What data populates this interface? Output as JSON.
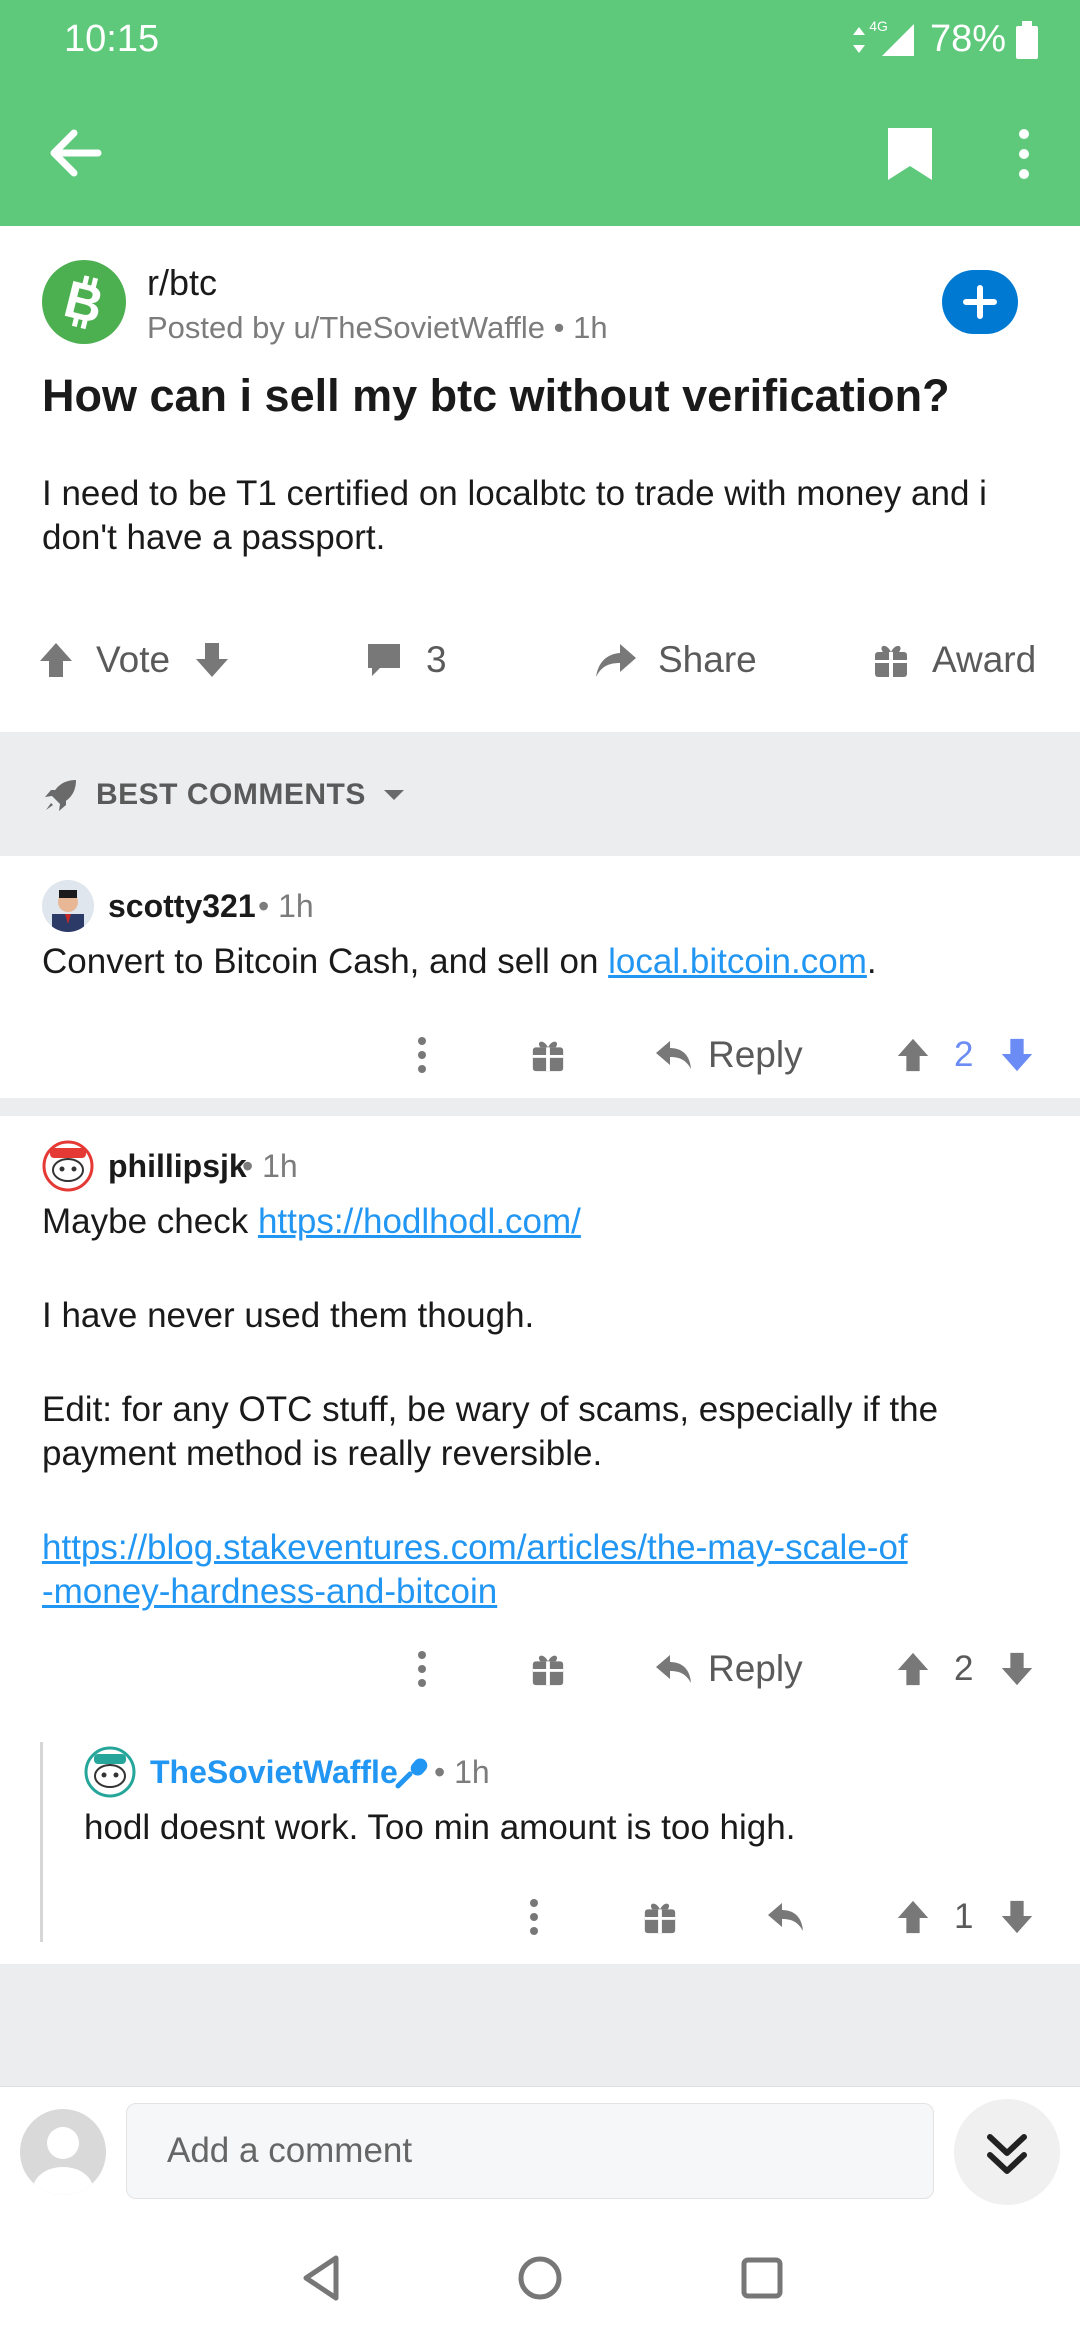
{
  "status_bar": {
    "time": "10:15",
    "network": "4G",
    "battery": "78%"
  },
  "post": {
    "subreddit": "r/btc",
    "meta": "Posted by u/TheSovietWaffle • 1h",
    "title": "How can i sell my btc without verification?",
    "body": "I need to be T1 certified on localbtc to trade with money and i don't have a passport.",
    "vote_label": "Vote",
    "comment_count": "3",
    "share_label": "Share",
    "award_label": "Award"
  },
  "sort": {
    "label": "BEST COMMENTS"
  },
  "comments": [
    {
      "author": "scotty321",
      "time": "• 1h",
      "text_pre": "Convert to Bitcoin Cash, and sell on ",
      "link": "local.bitcoin.com",
      "text_post": ".",
      "reply_label": "Reply",
      "score": "2"
    },
    {
      "author": "phillipsjk",
      "time": "• 1h",
      "line1_pre": "Maybe check ",
      "line1_link": "https://hodlhodl.com/",
      "para2": "I have never used them though.",
      "para3": "Edit: for any OTC stuff, be wary of scams, especially if the payment method is really reversible.",
      "link2_line1": "https://blog.stakeventures.com/articles/the-may-scale-of",
      "link2_line2": "-money-hardness-and-bitcoin",
      "reply_label": "Reply",
      "score": "2"
    },
    {
      "author": "TheSovietWaffle",
      "time": "• 1h",
      "text": "hodl doesnt work. Too min amount is too high.",
      "score": "1"
    }
  ],
  "compose": {
    "placeholder": "Add a comment"
  },
  "colors": {
    "header": "#5ec97a",
    "accent_blue": "#0079d3",
    "link": "#2196f3",
    "upvote_blue": "#6b8cf5"
  }
}
